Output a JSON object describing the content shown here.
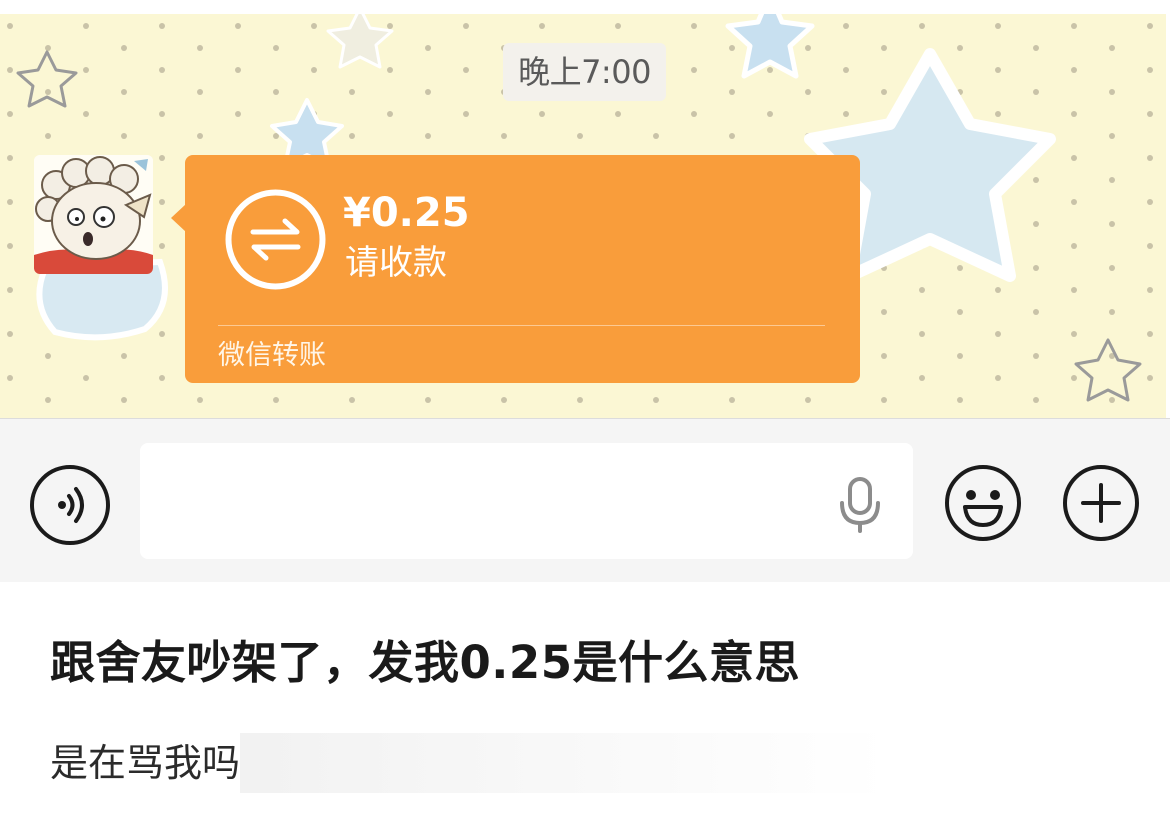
{
  "chat": {
    "timestamp": "晚上7:00",
    "transfer": {
      "amount": "¥0.25",
      "label": "请收款",
      "footer": "微信转账",
      "bubble_color": "#f99d3b",
      "icon": "transfer-arrows-icon"
    },
    "avatar": "pleasant-goat-avatar",
    "background_color": "#fbf7d4"
  },
  "input_bar": {
    "voice_icon": "voice-icon",
    "text_value": "",
    "mic_icon": "microphone-icon",
    "emoji_icon": "emoji-icon",
    "more_icon": "plus-icon"
  },
  "post": {
    "title": "跟舍友吵架了，发我0.25是什么意思",
    "body": "是在骂我吗"
  }
}
